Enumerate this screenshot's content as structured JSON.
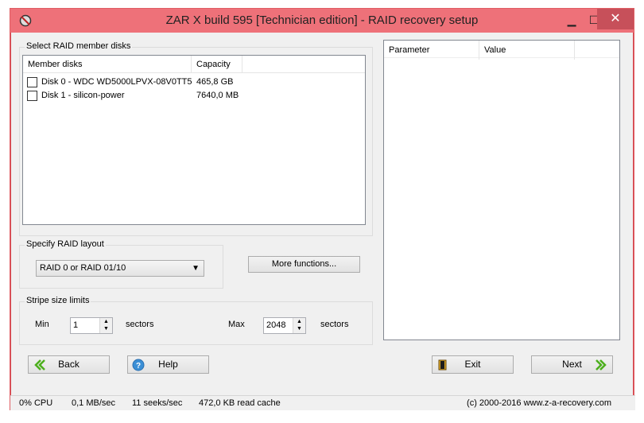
{
  "window": {
    "title": "ZAR X build 595 [Technician edition] - RAID recovery setup",
    "controls": {
      "minimize": "▁",
      "maximize": "☐",
      "close": "✕"
    }
  },
  "members_group": {
    "label": "Select RAID member disks",
    "columns": [
      "Member disks",
      "Capacity"
    ],
    "disks": [
      {
        "name": "Disk 0 - WDC WD5000LPVX-08V0TT5",
        "capacity": "465,8 GB",
        "checked": false
      },
      {
        "name": "Disk 1 - silicon-power",
        "capacity": "7640,0 MB",
        "checked": false
      }
    ]
  },
  "layout_group": {
    "label": "Specify RAID layout",
    "selected": "RAID 0 or RAID 01/10"
  },
  "more_functions_button": "More functions...",
  "stripe_group": {
    "label": "Stripe size limits",
    "min_label": "Min",
    "min_value": "1",
    "max_label": "Max",
    "max_value": "2048",
    "unit": "sectors"
  },
  "param_list": {
    "columns": [
      "Parameter",
      "Value"
    ]
  },
  "buttons": {
    "back": "Back",
    "help": "Help",
    "exit": "Exit",
    "next": "Next"
  },
  "status": {
    "cpu": "0% CPU",
    "rate": "0,1 MB/sec",
    "seeks": "11 seeks/sec",
    "cache": "472,0 KB read cache",
    "copyright": "(c) 2000-2016 www.z-a-recovery.com"
  },
  "colors": {
    "titlebar": "#ee7179",
    "close_button": "#c7505a",
    "accent_green": "#4caf1c"
  }
}
